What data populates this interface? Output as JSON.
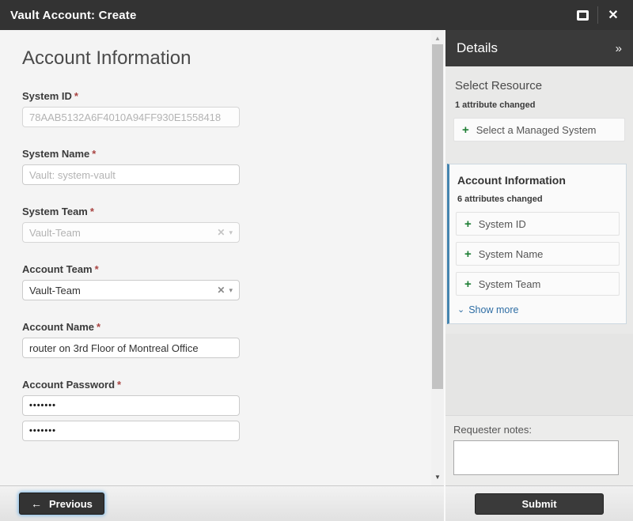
{
  "window": {
    "title": "Vault Account: Create"
  },
  "icons": {
    "close": "✕",
    "collapse_chevron": "»",
    "plus": "+",
    "clear": "✕",
    "caret_down": "▾",
    "chevron_down": "⌄",
    "arrow_left": "←",
    "scroll_up": "▲",
    "scroll_down": "▼"
  },
  "colors": {
    "titlebar_bg": "#333333",
    "details_header_bg": "#3a3a3a",
    "accent_blue": "#4484af",
    "link_blue": "#2e6da4",
    "plus_green": "#1e7e34",
    "required_red": "#a94442"
  },
  "form": {
    "heading": "Account Information",
    "fields": [
      {
        "label": "System ID",
        "required": "*",
        "value": "78AAB5132A6F4010A94FF930E1558418"
      },
      {
        "label": "System Name",
        "required": "*",
        "placeholder": "Vault: system-vault"
      },
      {
        "label": "System Team",
        "required": "*",
        "value": "Vault-Team"
      },
      {
        "label": "Account Team",
        "required": "*",
        "value": "Vault-Team"
      },
      {
        "label": "Account Name",
        "required": "*",
        "value": "router on 3rd Floor of Montreal Office"
      },
      {
        "label": "Account Password",
        "required": "*",
        "value": "•••••••",
        "confirm_value": "•••••••"
      }
    ]
  },
  "details": {
    "title": "Details",
    "select_resource": {
      "heading": "Select Resource",
      "status": "1 attribute changed",
      "button_label": "Select a Managed System"
    },
    "account_information": {
      "heading": "Account Information",
      "status": "6 attributes changed",
      "buttons": [
        "System ID",
        "System Name",
        "System Team"
      ],
      "show_more_label": "Show more"
    },
    "requester_notes_label": "Requester notes:"
  },
  "footer": {
    "previous_label": "Previous",
    "submit_label": "Submit"
  }
}
